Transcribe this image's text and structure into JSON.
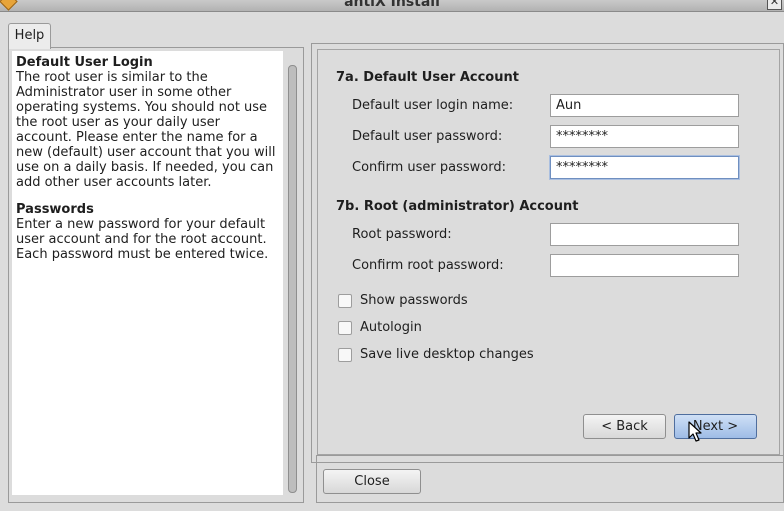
{
  "window": {
    "title": "antiX Install"
  },
  "help": {
    "tab_label": "Help",
    "sections": [
      {
        "heading": "Default User Login",
        "body": "The root user is similar to the Administrator user in some other operating systems. You should not use the root user as your daily user account. Please enter the name for a new (default) user account that you will use on a daily basis. If needed, you can add other user accounts later."
      },
      {
        "heading": "Passwords",
        "body": "Enter a new password for your default user account and for the root account. Each password must be entered twice."
      }
    ]
  },
  "form": {
    "user_section_title": "7a. Default User Account",
    "login_name": {
      "label": "Default user login name:",
      "value": "Aun"
    },
    "user_password": {
      "label": "Default user password:",
      "value": "********"
    },
    "confirm_user_password": {
      "label": "Confirm user password:",
      "value": "********"
    },
    "root_section_title": "7b. Root (administrator) Account",
    "root_password": {
      "label": "Root password:",
      "value": ""
    },
    "confirm_root_password": {
      "label": "Confirm root password:",
      "value": ""
    },
    "options": [
      {
        "label": "Show passwords",
        "checked": false
      },
      {
        "label": "Autologin",
        "checked": false
      },
      {
        "label": "Save live desktop changes",
        "checked": false
      }
    ]
  },
  "buttons": {
    "back": "< Back",
    "next": "Next >",
    "close": "Close"
  },
  "icons": {
    "app": "antix-installer-icon",
    "close": "close-icon",
    "cursor": "mouse-pointer-icon"
  }
}
